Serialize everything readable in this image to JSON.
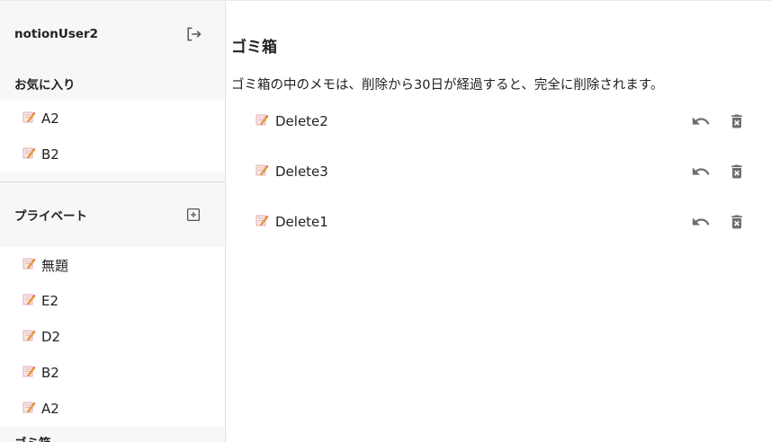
{
  "sidebar": {
    "user_name": "notionUser2",
    "favorites": {
      "title": "お気に入り",
      "items": [
        {
          "label": "A2"
        },
        {
          "label": "B2"
        }
      ]
    },
    "private": {
      "title": "プライベート",
      "items": [
        {
          "label": "無題"
        },
        {
          "label": "E2"
        },
        {
          "label": "D2"
        },
        {
          "label": "B2"
        },
        {
          "label": "A2"
        }
      ]
    },
    "trash_label": "ゴミ箱"
  },
  "main": {
    "title": "ゴミ箱",
    "description": "ゴミ箱の中のメモは、削除から30日が経過すると、完全に削除されます。",
    "items": [
      {
        "label": "Delete2"
      },
      {
        "label": "Delete3"
      },
      {
        "label": "Delete1"
      }
    ]
  },
  "icons": {
    "logout": "logout-icon",
    "add": "add-box-icon",
    "memo": "memo-icon",
    "restore": "undo-icon",
    "delete": "delete-forever-icon"
  },
  "colors": {
    "sidebar_bg": "#f7f7f7",
    "icon_gray": "#6f6f6f",
    "text": "#222222"
  }
}
